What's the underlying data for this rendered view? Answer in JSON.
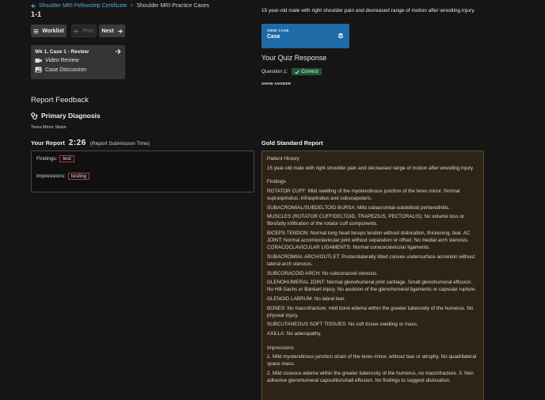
{
  "breadcrumb": {
    "parent": "Shoulder MRI Fellowship Certificate",
    "separator": ">",
    "current": "Shoulder MRI Practice Cases"
  },
  "case_id": "1-1",
  "nav": {
    "worklist": "Worklist",
    "prev": "Prev",
    "next": "Next"
  },
  "review": {
    "title": "Wk 1, Case 1 - Review",
    "items": [
      {
        "label": "Video Review",
        "icon": "video-icon"
      },
      {
        "label": "Case Discussion",
        "icon": "image-icon"
      }
    ]
  },
  "report_feedback": {
    "title": "Report Feedback",
    "primary_diagnosis_label": "Primary Diagnosis",
    "primary_diagnosis_value": "Teres Minor Strain"
  },
  "your_report": {
    "label": "Your Report",
    "time": "2:26",
    "time_note": "(Report Submission Time)",
    "findings_label": "Findings:",
    "findings_value": "test",
    "impressions_label": "Impressions:",
    "impressions_value": "testing"
  },
  "history": "15 year-old male with right shoulder pain and decreased range of motion after wrestling injury.",
  "view_case": {
    "small": "VIEW CASE",
    "label": "Case"
  },
  "quiz": {
    "title": "Your Quiz Response",
    "question_label": "Question 1:",
    "result": "Correct",
    "show_answer": "SHOW ANSWER"
  },
  "gold": {
    "title": "Gold Standard Report",
    "history_header": "Patient History",
    "history_text": "15 year-old male with right shoulder pain and decreased range of motion after wrestling injury.",
    "findings_header": "Findings",
    "findings": [
      "ROTATOR CUFF: Mild swelling of the myotendinous junction of the teres minor. Normal supraspinatus, infraspinatus and subscapularis.",
      "SUBACROMIAL/SUBDELTOID BURSA: Mild subacromial-subdeltoid peritendinitis.",
      "MUSCLES (ROTATOR CUFF/DELTOID, TRAPEZIUS, PECTORALIS): No volume loss or fibrofatty infiltration of the rotator cuff components.",
      "BICEPS TENDON: Normal long head biceps tendon without dislocation, thickening, tear. AC JOINT: Normal acromioclavicular joint without separation or offset. No medial arch stenosis. CORACOCLAVICULAR LIGAMENTS: Normal coracoclavicular ligaments.",
      "SUBACROMIAL ARCH/OUTLET: Posterolaterally tilted convex undersurface acromion without lateral arch stenosis.",
      "SUBCORACOID ARCH: No subcoracoid stenosis.",
      "GLENOHUMERAL JOINT: Normal glenohumeral joint cartilage. Small glenohumeral effusion. No Hill-Sachs or Bankart injury. No avulsion of the glenohumeral ligaments or capsular rupture.",
      "GLENOID LABRUM: No labral tear.",
      "BONES: No macrofracture; mild bone edema within the greater tuberosity of the humerus. No physeal injury.",
      "SUBCUTANEOUS SOFT TISSUES: No soft tissue swelling or mass.",
      "AXILLA: No adenopathy."
    ],
    "impressions_header": "Impressions",
    "impressions": [
      "1. Mild myotendinous junction strain of the teres minor, without tear or atrophy. No quadrilateral space mass.",
      "2. Mild osseous edema within the greater tuberosity of the humerus, no macrofracture. 3. Non adhesive glenohumeral capsulitis/small effusion. No findings to suggest dislocation."
    ]
  },
  "colors": {
    "background": "#151515",
    "accent_blue": "#1e6aa6",
    "link": "#5aa8d6",
    "correct_badge": "#1d5a3c",
    "gold_box": "#2d2416",
    "tag_border": "#b03a3a"
  }
}
